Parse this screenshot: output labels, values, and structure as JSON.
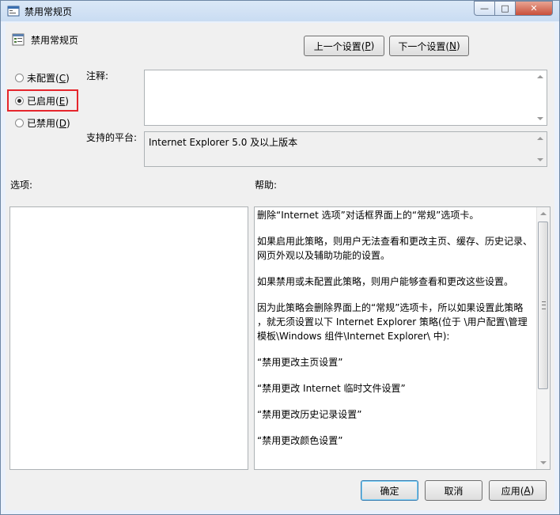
{
  "window": {
    "title": "禁用常规页"
  },
  "header": {
    "policy_title": "禁用常规页"
  },
  "nav": {
    "prev_label": "上一个设置(",
    "prev_key": "P",
    "prev_tail": ")",
    "next_label": "下一个设置(",
    "next_key": "N",
    "next_tail": ")"
  },
  "state": {
    "options": [
      {
        "label": "未配置(",
        "key": "C",
        "tail": ")",
        "selected": false
      },
      {
        "label": "已启用(",
        "key": "E",
        "tail": ")",
        "selected": true
      },
      {
        "label": "已禁用(",
        "key": "D",
        "tail": ")",
        "selected": false
      }
    ],
    "highlight_color": "#e5262d"
  },
  "comment": {
    "label": "注释:",
    "value": ""
  },
  "platform": {
    "label": "支持的平台:",
    "value": "Internet Explorer 5.0 及以上版本"
  },
  "options_panel": {
    "label": "选项:"
  },
  "help_panel": {
    "label": "帮助:",
    "paragraphs": [
      [
        "删除“Internet 选项”对话框界面上的“常规”选项卡。"
      ],
      [
        "如果启用此策略，则用户无法查看和更改主页、缓存、历史记录、",
        "网页外观以及辅助功能的设置。"
      ],
      [
        "如果禁用或未配置此策略，则用户能够查看和更改这些设置。"
      ],
      [
        "因为此策略会删除界面上的“常规”选项卡，所以如果设置此策略",
        "，就无须设置以下 Internet Explorer 策略(位于 \\用户配置\\管理",
        "模板\\Windows 组件\\Internet Explorer\\ 中):"
      ],
      [
        " “禁用更改主页设置”"
      ],
      [
        " “禁用更改 Internet 临时文件设置”"
      ],
      [
        " “禁用更改历史记录设置”"
      ],
      [
        " “禁用更改颜色设置”"
      ]
    ]
  },
  "footer": {
    "ok_label": "确定",
    "cancel_label": "取消",
    "apply_label": "应用(",
    "apply_key": "A",
    "apply_tail": ")"
  }
}
